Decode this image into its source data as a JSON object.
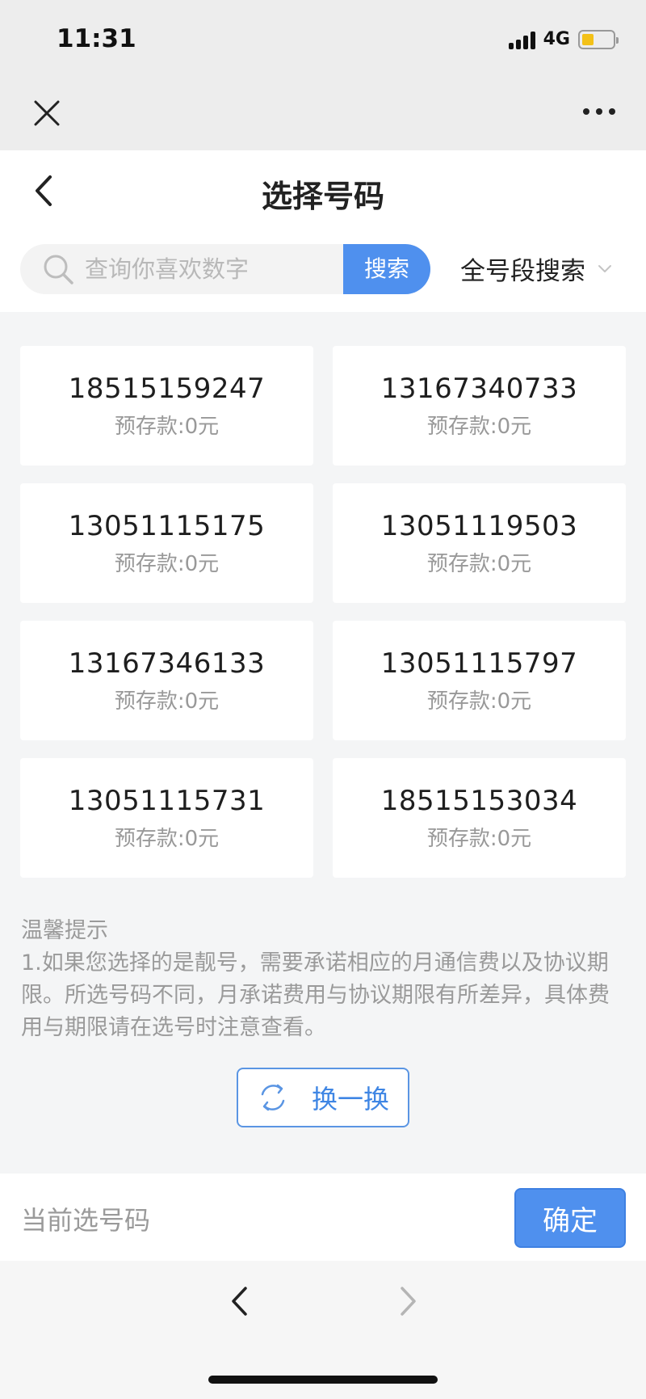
{
  "status": {
    "time": "11:31",
    "network": "4G",
    "battery_level": 0.4,
    "battery_color": "#f3c118"
  },
  "webview": {
    "close_icon": "close-icon",
    "more_icon": "more-dots-icon"
  },
  "header": {
    "back_icon": "chevron-left-icon",
    "title": "选择号码"
  },
  "search": {
    "placeholder": "查询你喜欢数字",
    "value": "",
    "button_label": "搜索",
    "segment_label": "全号段搜索",
    "segment_icon": "chevron-down-icon"
  },
  "numbers": [
    {
      "number": "18515159247",
      "deposit": "预存款:0元"
    },
    {
      "number": "13167340733",
      "deposit": "预存款:0元"
    },
    {
      "number": "13051115175",
      "deposit": "预存款:0元"
    },
    {
      "number": "13051119503",
      "deposit": "预存款:0元"
    },
    {
      "number": "13167346133",
      "deposit": "预存款:0元"
    },
    {
      "number": "13051115797",
      "deposit": "预存款:0元"
    },
    {
      "number": "13051115731",
      "deposit": "预存款:0元"
    },
    {
      "number": "18515153034",
      "deposit": "预存款:0元"
    }
  ],
  "tips": {
    "title": "温馨提示",
    "body": "1.如果您选择的是靓号，需要承诺相应的月通信费以及协议期限。所选号码不同，月承诺费用与协议期限有所差异，具体费用与期限请在选号时注意查看。"
  },
  "refresh": {
    "label": "换一换",
    "icon": "refresh-icon"
  },
  "footer": {
    "current_label": "当前选号码",
    "confirm_label": "确定"
  },
  "nav": {
    "back_icon": "nav-back-icon",
    "forward_icon": "nav-forward-icon"
  },
  "colors": {
    "accent": "#4f90ee",
    "background": "#f4f5f6"
  }
}
